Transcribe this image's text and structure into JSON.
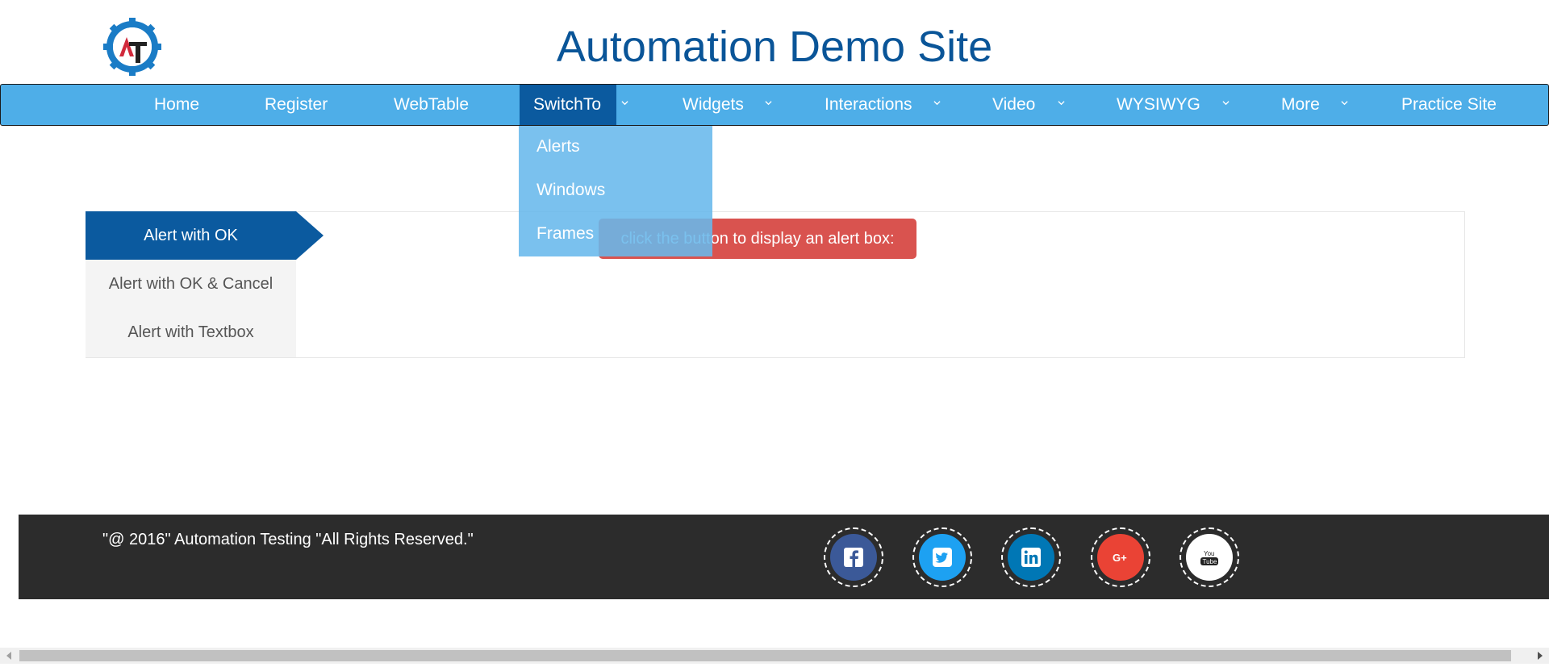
{
  "header": {
    "title": "Automation Demo Site",
    "logo_text": "AT"
  },
  "nav": {
    "items": [
      {
        "label": "Home",
        "has_dropdown": false
      },
      {
        "label": "Register",
        "has_dropdown": false
      },
      {
        "label": "WebTable",
        "has_dropdown": false
      },
      {
        "label": "SwitchTo",
        "has_dropdown": true,
        "active": true
      },
      {
        "label": "Widgets",
        "has_dropdown": true
      },
      {
        "label": "Interactions",
        "has_dropdown": true
      },
      {
        "label": "Video",
        "has_dropdown": true
      },
      {
        "label": "WYSIWYG",
        "has_dropdown": true
      },
      {
        "label": "More",
        "has_dropdown": true
      },
      {
        "label": "Practice Site",
        "has_dropdown": false
      }
    ],
    "dropdown": [
      "Alerts",
      "Windows",
      "Frames"
    ]
  },
  "tabs": {
    "items": [
      "Alert with OK",
      "Alert with OK & Cancel",
      "Alert with Textbox"
    ],
    "active_index": 0
  },
  "content": {
    "button_label": "click the button to display an alert box:"
  },
  "footer": {
    "copyright": "\"@ 2016\" Automation Testing \"All Rights Reserved.\"",
    "social": [
      {
        "name": "facebook-icon",
        "color": "#3b5998"
      },
      {
        "name": "twitter-icon",
        "color": "#1da1f2"
      },
      {
        "name": "linkedin-icon",
        "color": "#0077b5"
      },
      {
        "name": "google-plus-icon",
        "color": "#ea4335"
      },
      {
        "name": "youtube-icon",
        "color": "#ffffff"
      }
    ]
  },
  "colors": {
    "nav_bg": "#4eaee8",
    "nav_active": "#0b5a9f",
    "title": "#0a5598",
    "alert_button": "#d9534f",
    "footer_bg": "#2c2c2c"
  }
}
